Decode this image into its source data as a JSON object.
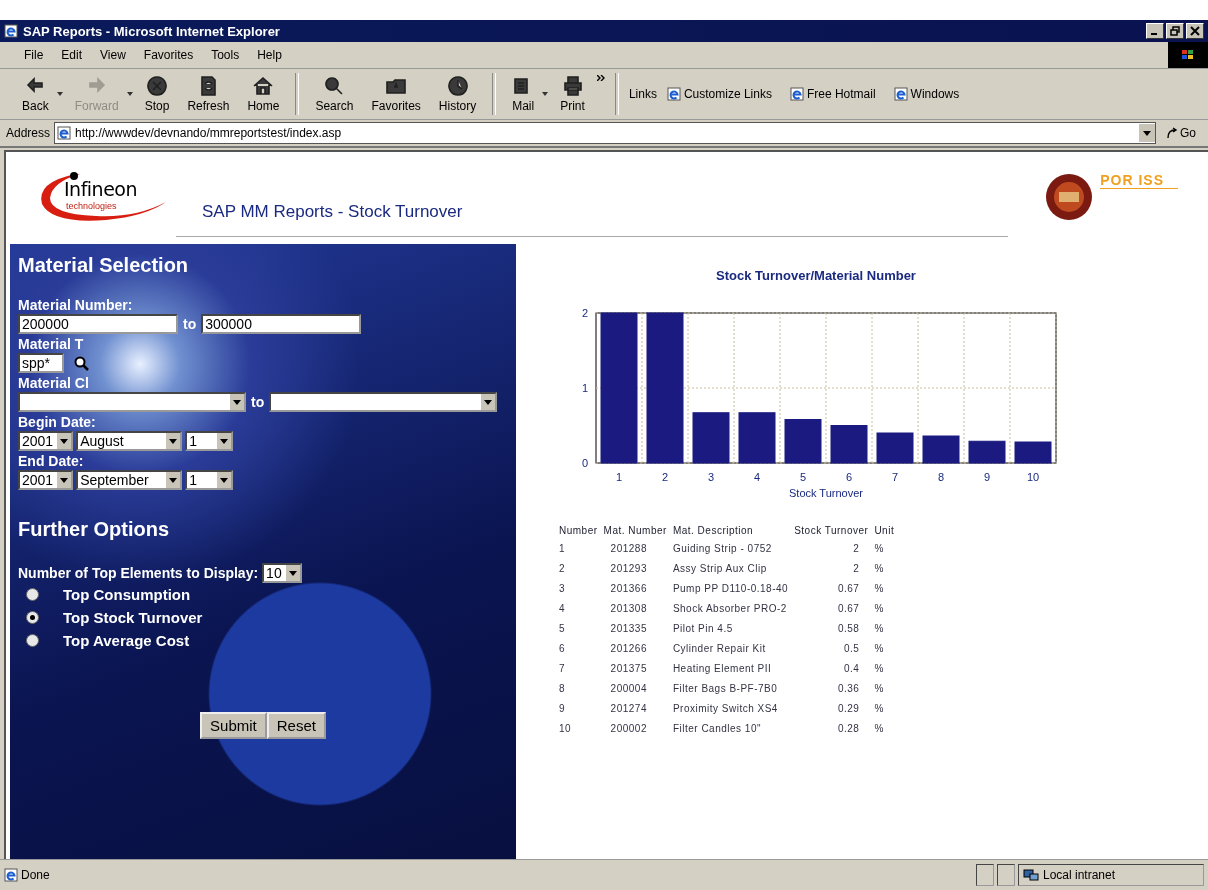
{
  "window": {
    "title": "SAP Reports - Microsoft Internet Explorer"
  },
  "menu": [
    {
      "label": "File"
    },
    {
      "label": "Edit"
    },
    {
      "label": "View"
    },
    {
      "label": "Favorites"
    },
    {
      "label": "Tools"
    },
    {
      "label": "Help"
    }
  ],
  "toolbar": [
    {
      "label": "Back",
      "kind": "back",
      "disabled": false,
      "dropdown": true
    },
    {
      "label": "Forward",
      "kind": "forward",
      "disabled": true,
      "dropdown": true
    },
    {
      "label": "Stop",
      "kind": "stop",
      "disabled": false,
      "dropdown": false
    },
    {
      "label": "Refresh",
      "kind": "refresh",
      "disabled": false,
      "dropdown": false
    },
    {
      "label": "Home",
      "kind": "home",
      "disabled": false,
      "dropdown": false
    },
    {
      "label": "Search",
      "kind": "search",
      "disabled": false,
      "dropdown": false
    },
    {
      "label": "Favorites",
      "kind": "favorites",
      "disabled": false,
      "dropdown": false
    },
    {
      "label": "History",
      "kind": "history",
      "disabled": false,
      "dropdown": false
    },
    {
      "label": "Mail",
      "kind": "mail",
      "disabled": false,
      "dropdown": true
    },
    {
      "label": "Print",
      "kind": "print",
      "disabled": false,
      "dropdown": false
    }
  ],
  "links": {
    "label": "Links",
    "items": [
      "Customize Links",
      "Free Hotmail",
      "Windows"
    ]
  },
  "address": {
    "label": "Address",
    "url": "http://wwwdev/devnando/mmreportstest/index.asp",
    "go": "Go"
  },
  "header": {
    "logo": "Infineon",
    "logo_sub": "technologies",
    "title": "SAP MM Reports - Stock Turnover",
    "badge": "POR ISS"
  },
  "form": {
    "title": "Material Selection",
    "material_number": {
      "label": "Material Number:",
      "from": "200000",
      "to_label": "to",
      "to": "300000"
    },
    "material_type": {
      "label": "Material T",
      "value": "spp*"
    },
    "material_class": {
      "label": "Material Cl",
      "to_label": "to"
    },
    "begin_date": {
      "label": "Begin Date:",
      "year": "2001",
      "month": "August",
      "day": "1"
    },
    "end_date": {
      "label": "End Date:",
      "year": "2001",
      "month": "September",
      "day": "1"
    },
    "further_title": "Further Options",
    "top_elements": {
      "label": "Number of Top Elements to Display:",
      "value": "10"
    },
    "options": [
      {
        "label": "Top Consumption",
        "selected": false
      },
      {
        "label": "Top Stock Turnover",
        "selected": true
      },
      {
        "label": "Top Average Cost",
        "selected": false
      }
    ],
    "buttons": [
      "Submit",
      "Reset"
    ]
  },
  "chart_data": {
    "type": "bar",
    "title": "Stock Turnover/Material Number",
    "xlabel": "Stock Turnover",
    "categories": [
      "1",
      "2",
      "3",
      "4",
      "5",
      "6",
      "7",
      "8",
      "9",
      "10"
    ],
    "series": [
      {
        "color": "#1a1a80",
        "values": [
          2,
          2,
          0.67,
          0.67,
          0.58,
          0.5,
          0.4,
          0.36,
          0.29,
          0.28
        ]
      }
    ],
    "ylim": [
      0,
      2
    ],
    "yticks": [
      0,
      1,
      2
    ]
  },
  "table": {
    "columns": [
      "Number",
      "Mat. Number",
      "Mat. Description",
      "Stock Turnover",
      "Unit"
    ],
    "rows": [
      [
        "1",
        "201288",
        "Guiding Strip - 0752",
        "2",
        "%"
      ],
      [
        "2",
        "201293",
        "Assy Strip Aux Clip",
        "2",
        "%"
      ],
      [
        "3",
        "201366",
        "Pump PP D110-0.18-40",
        "0.67",
        "%"
      ],
      [
        "4",
        "201308",
        "Shock Absorber PRO-2",
        "0.67",
        "%"
      ],
      [
        "5",
        "201335",
        "Pilot Pin 4.5",
        "0.58",
        "%"
      ],
      [
        "6",
        "201266",
        "Cylinder Repair Kit",
        "0.5",
        "%"
      ],
      [
        "7",
        "201375",
        "Heating Element PII",
        "0.4",
        "%"
      ],
      [
        "8",
        "200004",
        "Filter Bags B-PF-7B0",
        "0.36",
        "%"
      ],
      [
        "9",
        "201274",
        "Proximity Switch XS4",
        "0.29",
        "%"
      ],
      [
        "10",
        "200002",
        "Filter Candles 10\"",
        "0.28",
        "%"
      ]
    ]
  },
  "status_bar": {
    "text": "Done",
    "zone": "Local intranet"
  }
}
